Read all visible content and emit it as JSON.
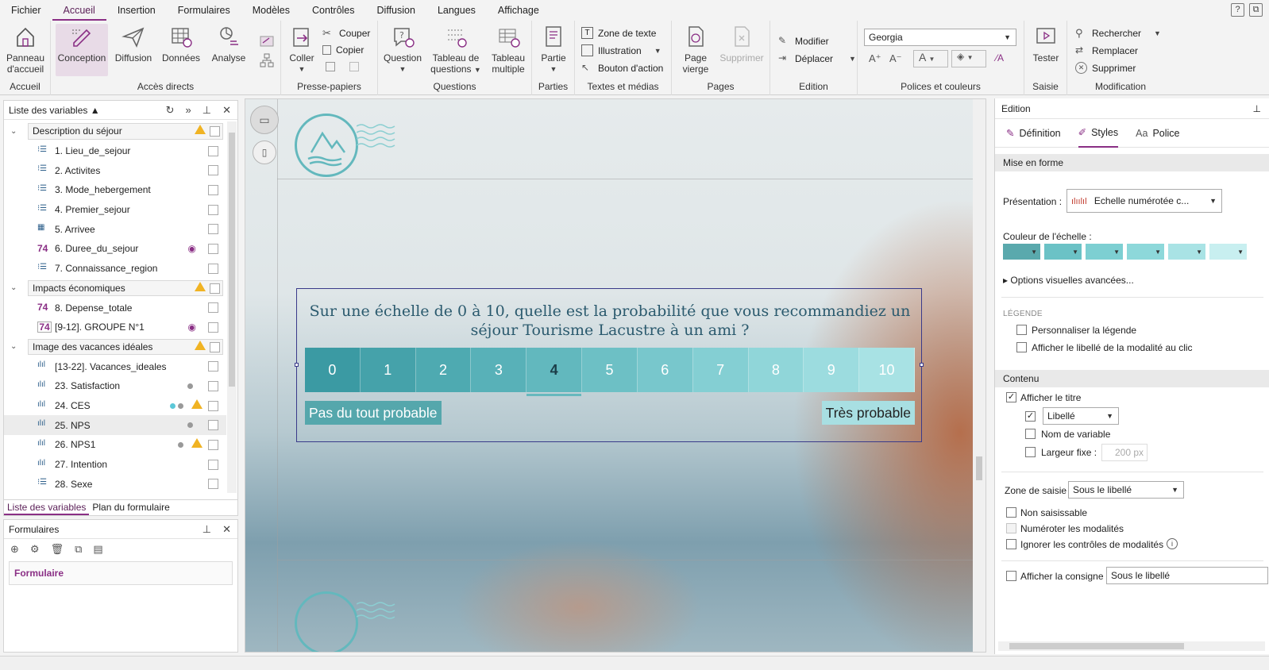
{
  "menu": {
    "items": [
      "Fichier",
      "Accueil",
      "Insertion",
      "Formulaires",
      "Modèles",
      "Contrôles",
      "Diffusion",
      "Langues",
      "Affichage"
    ],
    "active": "Accueil",
    "help": "?",
    "restore": "⧉"
  },
  "ribbon": {
    "accueil_group": {
      "label": "Accueil",
      "panneau": "Panneau d'accueil"
    },
    "acces_group": {
      "label": "Accès directs",
      "conception": "Conception",
      "diffusion": "Diffusion",
      "donnees": "Données",
      "analyse": "Analyse"
    },
    "presse_group": {
      "label": "Presse-papiers",
      "coller": "Coller",
      "couper": "Couper",
      "copier": "Copier"
    },
    "questions_group": {
      "label": "Questions",
      "question": "Question",
      "tableau_questions": "Tableau de questions",
      "tableau_multiple": "Tableau multiple"
    },
    "parties_group": {
      "label": "Parties",
      "partie": "Partie"
    },
    "textes_group": {
      "label": "Textes et médias",
      "zone_texte": "Zone de texte",
      "illustration": "Illustration",
      "bouton_action": "Bouton d'action"
    },
    "pages_group": {
      "label": "Pages",
      "page_vierge": "Page vierge",
      "supprimer": "Supprimer"
    },
    "edition_group": {
      "label": "Edition",
      "modifier": "Modifier",
      "deplacer": "Déplacer"
    },
    "polices_group": {
      "label": "Polices et couleurs",
      "font": "Georgia"
    },
    "saisie_group": {
      "label": "Saisie",
      "tester": "Tester"
    },
    "modif_group": {
      "label": "Modification",
      "rechercher": "Rechercher",
      "remplacer": "Remplacer",
      "supprimer": "Supprimer"
    }
  },
  "varlist": {
    "title": "Liste des variables ▲",
    "rows": [
      {
        "kind": "group",
        "label": "Description du séjour",
        "warn": true
      },
      {
        "kind": "var",
        "label": "1. Lieu_de_sejour",
        "icon": "single-choice-icon"
      },
      {
        "kind": "var",
        "label": "2. Activites",
        "icon": "multi-choice-icon"
      },
      {
        "kind": "var",
        "label": "3. Mode_hebergement",
        "icon": "single-choice-icon"
      },
      {
        "kind": "var",
        "label": "4. Premier_sejour",
        "icon": "single-choice-icon"
      },
      {
        "kind": "var",
        "label": "5. Arrivee",
        "icon": "date-icon"
      },
      {
        "kind": "var",
        "label": "6. Duree_du_sejour",
        "icon": "numeric-icon",
        "eye": true
      },
      {
        "kind": "var",
        "label": "7. Connaissance_region",
        "icon": "multi-choice-icon"
      },
      {
        "kind": "group",
        "label": "Impacts économiques",
        "warn": true
      },
      {
        "kind": "var",
        "label": "8. Depense_totale",
        "icon": "numeric-icon"
      },
      {
        "kind": "var",
        "label": "[9-12]. GROUPE N°1",
        "icon": "numeric-group-icon",
        "eye": true
      },
      {
        "kind": "group",
        "label": "Image des vacances idéales",
        "warn": true
      },
      {
        "kind": "var",
        "label": "[13-22]. Vacances_ideales",
        "icon": "scale-table-icon"
      },
      {
        "kind": "var",
        "label": "23. Satisfaction",
        "icon": "scale-icon",
        "dots": [
          "#999"
        ]
      },
      {
        "kind": "var",
        "label": "24. CES",
        "icon": "scale-icon",
        "dots": [
          "#5cc8d8",
          "#999"
        ],
        "warn": true
      },
      {
        "kind": "var",
        "label": "25. NPS",
        "icon": "scale-icon",
        "dots": [
          "#999"
        ],
        "selected": true
      },
      {
        "kind": "var",
        "label": "26. NPS1",
        "icon": "scale-icon",
        "dots": [
          "#999"
        ],
        "warn": true
      },
      {
        "kind": "var",
        "label": "27. Intention",
        "icon": "scale-icon"
      },
      {
        "kind": "var",
        "label": "28. Sexe",
        "icon": "single-choice-icon"
      }
    ],
    "tab_variables": "Liste des variables",
    "tab_plan": "Plan du formulaire"
  },
  "forms": {
    "title": "Formulaires",
    "item": "Formulaire"
  },
  "question": {
    "title": "Sur une échelle de 0 à 10, quelle est la probabilité que vous recommandiez un séjour Tourisme Lacustre à un ami ?",
    "scale": [
      "0",
      "1",
      "2",
      "3",
      "4",
      "5",
      "6",
      "7",
      "8",
      "9",
      "10"
    ],
    "current": "4",
    "low_label": "Pas du tout probable",
    "high_label": "Très probable",
    "colors": [
      "#3b9aa3",
      "#45a2aa",
      "#4eaab1",
      "#58b1b8",
      "#62b8be",
      "#6dc0c5",
      "#78c7cc",
      "#84cfd3",
      "#90d6d9",
      "#9cdcdf",
      "#a8e2e4"
    ]
  },
  "edition": {
    "title": "Edition",
    "tabs": {
      "definition": "Définition",
      "styles": "Styles",
      "police": "Police"
    },
    "mise_en_forme": "Mise en forme",
    "presentation_label": "Présentation :",
    "presentation_value": "Echelle numérotée c...",
    "couleur_label": "Couleur de l'échelle :",
    "swatches": [
      "#5aa9ad",
      "#6bc2c6",
      "#7dcfd2",
      "#8dd8da",
      "#a9e3e5",
      "#c8eff0"
    ],
    "options_avancees": "Options visuelles avancées...",
    "legende": "LÉGENDE",
    "personnaliser": "Personnaliser la légende",
    "afficher_libelle": "Afficher le libellé de la modalité au clic",
    "contenu": "Contenu",
    "afficher_titre": "Afficher le titre",
    "libelle": "Libellé",
    "nom_variable": "Nom de variable",
    "largeur_fixe": "Largeur fixe :",
    "largeur_value": "200 px",
    "zone_saisie_label": "Zone de saisie",
    "zone_saisie_value": "Sous le libellé",
    "non_saisissable": "Non saisissable",
    "numeroter": "Numéroter les modalités",
    "ignorer": "Ignorer les contrôles de modalités",
    "afficher_consigne": "Afficher la consigne",
    "consigne_value": "Sous le libellé"
  }
}
